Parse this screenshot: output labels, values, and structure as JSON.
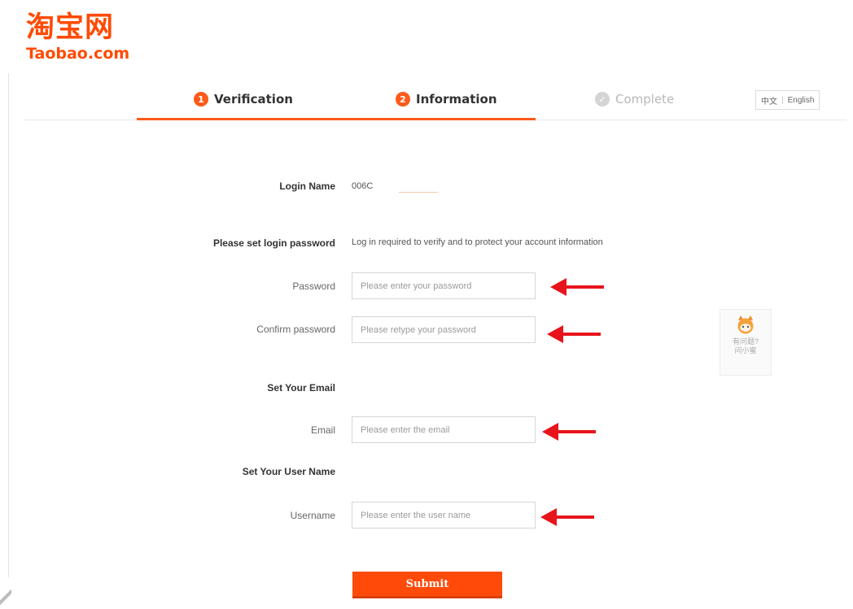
{
  "brand": {
    "logo_cn": "淘宝网",
    "logo_en": "Taobao.com",
    "accent_color": "#ff4a00"
  },
  "steps": [
    {
      "number": "1",
      "label": "Verification",
      "state": "done"
    },
    {
      "number": "2",
      "label": "Information",
      "state": "current"
    },
    {
      "number": "",
      "label": "Complete",
      "state": "pending"
    }
  ],
  "language": {
    "chinese_label": "中文",
    "separator": "|",
    "english_label": "English"
  },
  "form": {
    "login_name": {
      "label": "Login Name",
      "value": "006C"
    },
    "password_section": {
      "label": "Please set login password",
      "hint": "Log in required to verify and to protect your account information"
    },
    "password": {
      "label": "Password",
      "placeholder": "Please enter your password"
    },
    "confirm_password": {
      "label": "Confirm password",
      "placeholder": "Please retype your password"
    },
    "email_section": {
      "label": "Set Your Email"
    },
    "email": {
      "label": "Email",
      "placeholder": "Please enter the email"
    },
    "username_section": {
      "label": "Set Your User Name"
    },
    "username": {
      "label": "Username",
      "placeholder": "Please enter the user name"
    },
    "submit_label": "Submit"
  },
  "annotations": {
    "arrow_color": "#e8141c",
    "arrow_icon": "red-arrow-left-icon"
  },
  "help_widget": {
    "icon": "mascot-icon",
    "line1": "有问题?",
    "line2": "问小蜜"
  }
}
